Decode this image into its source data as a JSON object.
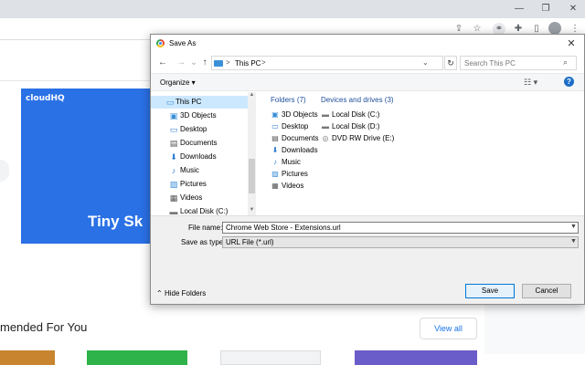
{
  "browser": {
    "window_controls": {
      "minimize": "—",
      "restore": "❐",
      "close": "✕"
    },
    "toolbar_icons": [
      "share-icon",
      "star-icon",
      "link-icon",
      "puzzle-icon",
      "sidebar-icon",
      "avatar",
      "more-icon"
    ]
  },
  "page": {
    "banner": {
      "brand": "cloudHQ",
      "title": "Tiny Sk"
    },
    "section_title": "mended For You",
    "view_all_label": "View all"
  },
  "dialog": {
    "title": "Save As",
    "close_glyph": "✕",
    "nav": {
      "back": "←",
      "forward": "→",
      "recent": "⌄",
      "up": "↑"
    },
    "address": {
      "crumb": "This PC",
      "sep": ">",
      "dropdown": "⌄"
    },
    "refresh_glyph": "↻",
    "search_placeholder": "Search This PC",
    "organize_label": "Organize ▾",
    "view_glyph": "☷ ▾",
    "help_glyph": "?",
    "nav_pane": [
      {
        "label": "This PC",
        "icon": "🖳",
        "selected": true
      },
      {
        "label": "3D Objects",
        "icon": "▣"
      },
      {
        "label": "Desktop",
        "icon": "▭"
      },
      {
        "label": "Documents",
        "icon": "▤"
      },
      {
        "label": "Downloads",
        "icon": "⬇"
      },
      {
        "label": "Music",
        "icon": "♪"
      },
      {
        "label": "Pictures",
        "icon": "▨"
      },
      {
        "label": "Videos",
        "icon": "▦"
      },
      {
        "label": "Local Disk (C:)",
        "icon": "▬"
      }
    ],
    "folders_header": "Folders (7)",
    "folders": [
      {
        "label": "3D Objects",
        "icon": "▣"
      },
      {
        "label": "Desktop",
        "icon": "▭"
      },
      {
        "label": "Documents",
        "icon": "▤"
      },
      {
        "label": "Downloads",
        "icon": "⬇"
      },
      {
        "label": "Music",
        "icon": "♪"
      },
      {
        "label": "Pictures",
        "icon": "▨"
      },
      {
        "label": "Videos",
        "icon": "▦"
      }
    ],
    "drives_header": "Devices and drives (3)",
    "drives": [
      {
        "label": "Local Disk (C:)",
        "icon": "▬"
      },
      {
        "label": "Local Disk (D:)",
        "icon": "▬"
      },
      {
        "label": "DVD RW Drive (E:)",
        "icon": "◎"
      }
    ],
    "file_name_label": "File name:",
    "file_name_value": "Chrome Web Store - Extensions.url",
    "save_type_label": "Save as type:",
    "save_type_value": "URL File (*.url)",
    "hide_folders_label": "Hide Folders",
    "save_label": "Save",
    "cancel_label": "Cancel"
  },
  "colors": {
    "banner": "#2a71e6",
    "selection": "#cce8ff",
    "accent": "#0078d7",
    "link": "#1a73e8"
  }
}
